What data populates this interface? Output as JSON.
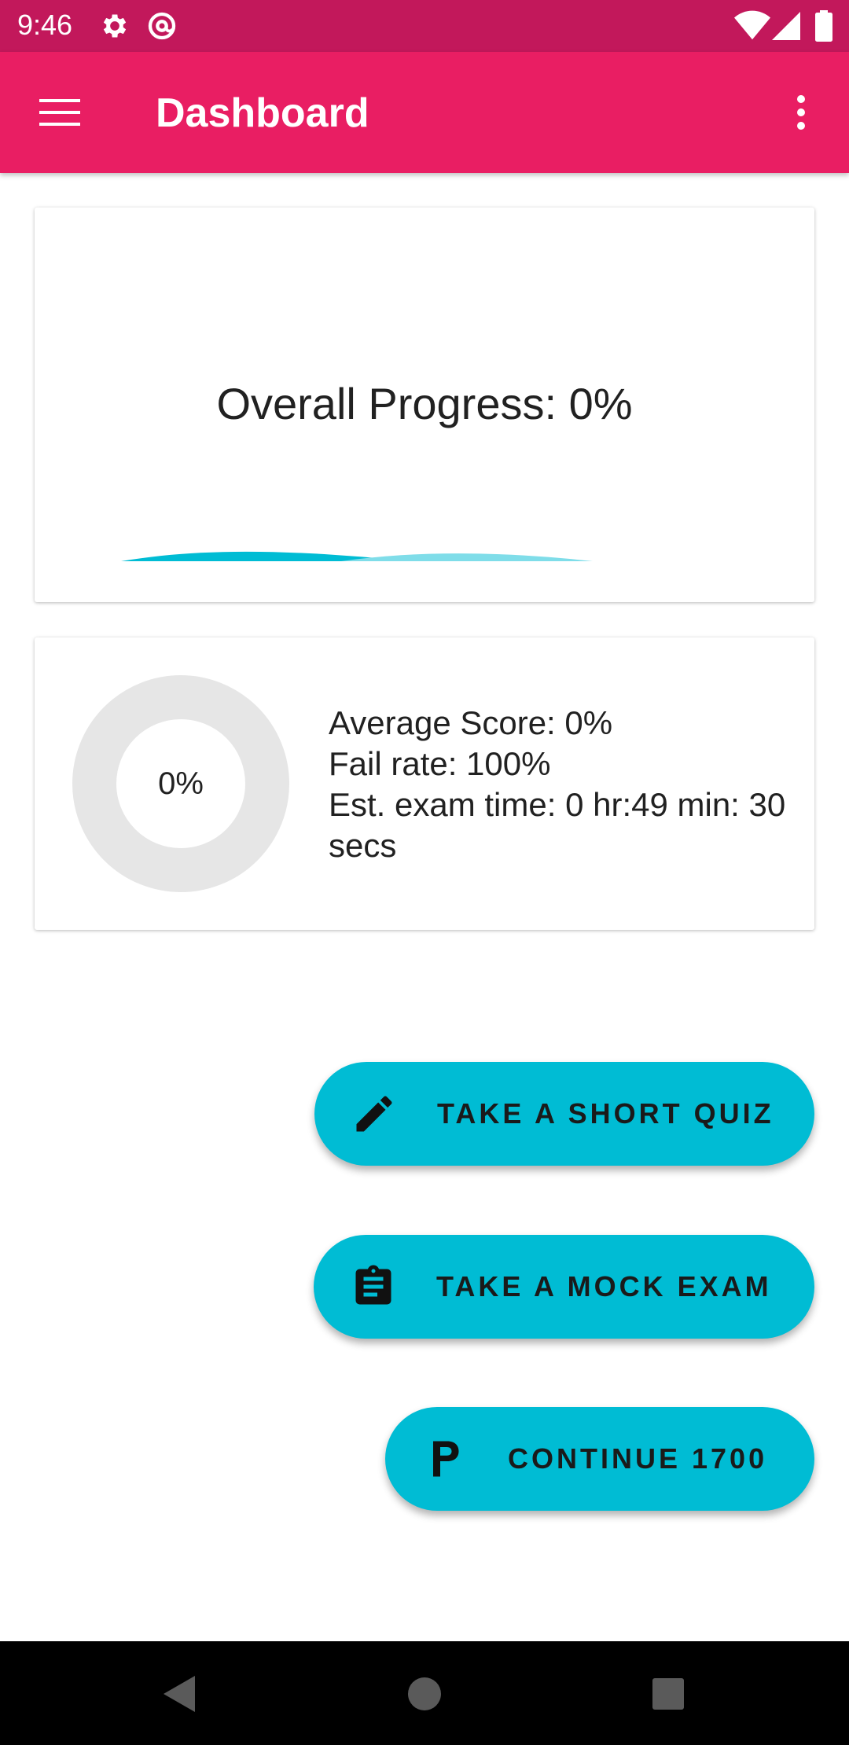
{
  "status_bar": {
    "time": "9:46",
    "icons": [
      "settings-icon",
      "at-sign-icon",
      "wifi-icon",
      "signal-icon",
      "battery-icon"
    ],
    "background": "#c2185b"
  },
  "app_bar": {
    "title": "Dashboard",
    "menu_icon": "hamburger-menu-icon",
    "overflow_icon": "more-vert-icon",
    "background": "#e91e63"
  },
  "progress_card": {
    "label": "Overall Progress: 0%",
    "progress_value": 0
  },
  "stats_card": {
    "donut_label": "0%",
    "donut_value": 0,
    "average_score": "Average Score: 0%",
    "fail_rate": "Fail rate: 100%",
    "exam_time": "Est. exam time: 0 hr:49 min: 30 secs"
  },
  "actions": {
    "short_quiz": {
      "label": "TAKE A SHORT QUIZ",
      "icon": "pencil-icon"
    },
    "mock_exam": {
      "label": "TAKE A MOCK EXAM",
      "icon": "clipboard-icon"
    },
    "continue": {
      "label": "CONTINUE 1700",
      "icon": "letter-p-icon"
    }
  },
  "colors": {
    "accent": "#00bcd4",
    "primary": "#e91e63",
    "primary_dark": "#c2185b",
    "donut_track": "#e6e6e6"
  },
  "nav_bar": {
    "icons": [
      "back-icon",
      "home-icon",
      "recents-icon"
    ]
  }
}
